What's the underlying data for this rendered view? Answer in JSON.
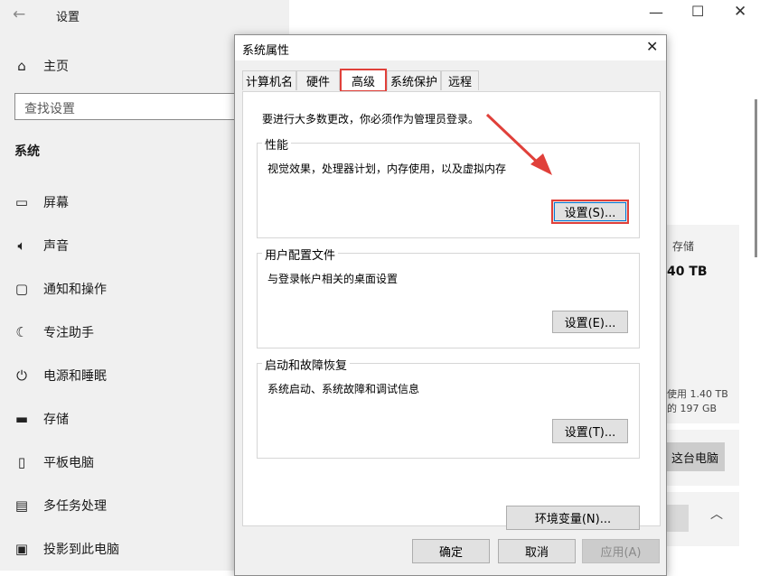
{
  "settings": {
    "title": "设置",
    "home_label": "主页",
    "search_placeholder": "查找设置",
    "section_label": "系统",
    "nav": [
      {
        "label": "屏幕",
        "icon": "display-icon"
      },
      {
        "label": "声音",
        "icon": "speaker-icon"
      },
      {
        "label": "通知和操作",
        "icon": "notification-icon"
      },
      {
        "label": "专注助手",
        "icon": "moon-icon"
      },
      {
        "label": "电源和睡眠",
        "icon": "power-icon"
      },
      {
        "label": "存储",
        "icon": "storage-icon"
      },
      {
        "label": "平板电脑",
        "icon": "tablet-icon"
      },
      {
        "label": "多任务处理",
        "icon": "multitask-icon"
      },
      {
        "label": "投影到此电脑",
        "icon": "project-icon"
      }
    ],
    "storage_card": {
      "title": "存储",
      "size": "40 TB",
      "used": "使用 1.40 TB",
      "free": "的 197 GB",
      "button": "这台电脑"
    }
  },
  "dialog": {
    "title": "系统属性",
    "tabs": [
      {
        "label": "计算机名"
      },
      {
        "label": "硬件"
      },
      {
        "label": "高级",
        "active": true
      },
      {
        "label": "系统保护"
      },
      {
        "label": "远程"
      }
    ],
    "notice": "要进行大多数更改，你必须作为管理员登录。",
    "performance": {
      "title": "性能",
      "desc": "视觉效果，处理器计划，内存使用，以及虚拟内存",
      "button": "设置(S)..."
    },
    "user_profiles": {
      "title": "用户配置文件",
      "desc": "与登录帐户相关的桌面设置",
      "button": "设置(E)..."
    },
    "startup_recovery": {
      "title": "启动和故障恢复",
      "desc": "系统启动、系统故障和调试信息",
      "button": "设置(T)..."
    },
    "env_button": "环境变量(N)...",
    "ok_button": "确定",
    "cancel_button": "取消",
    "apply_button": "应用(A)"
  },
  "colors": {
    "highlight": "#e0403a",
    "focus": "#0078d7"
  }
}
